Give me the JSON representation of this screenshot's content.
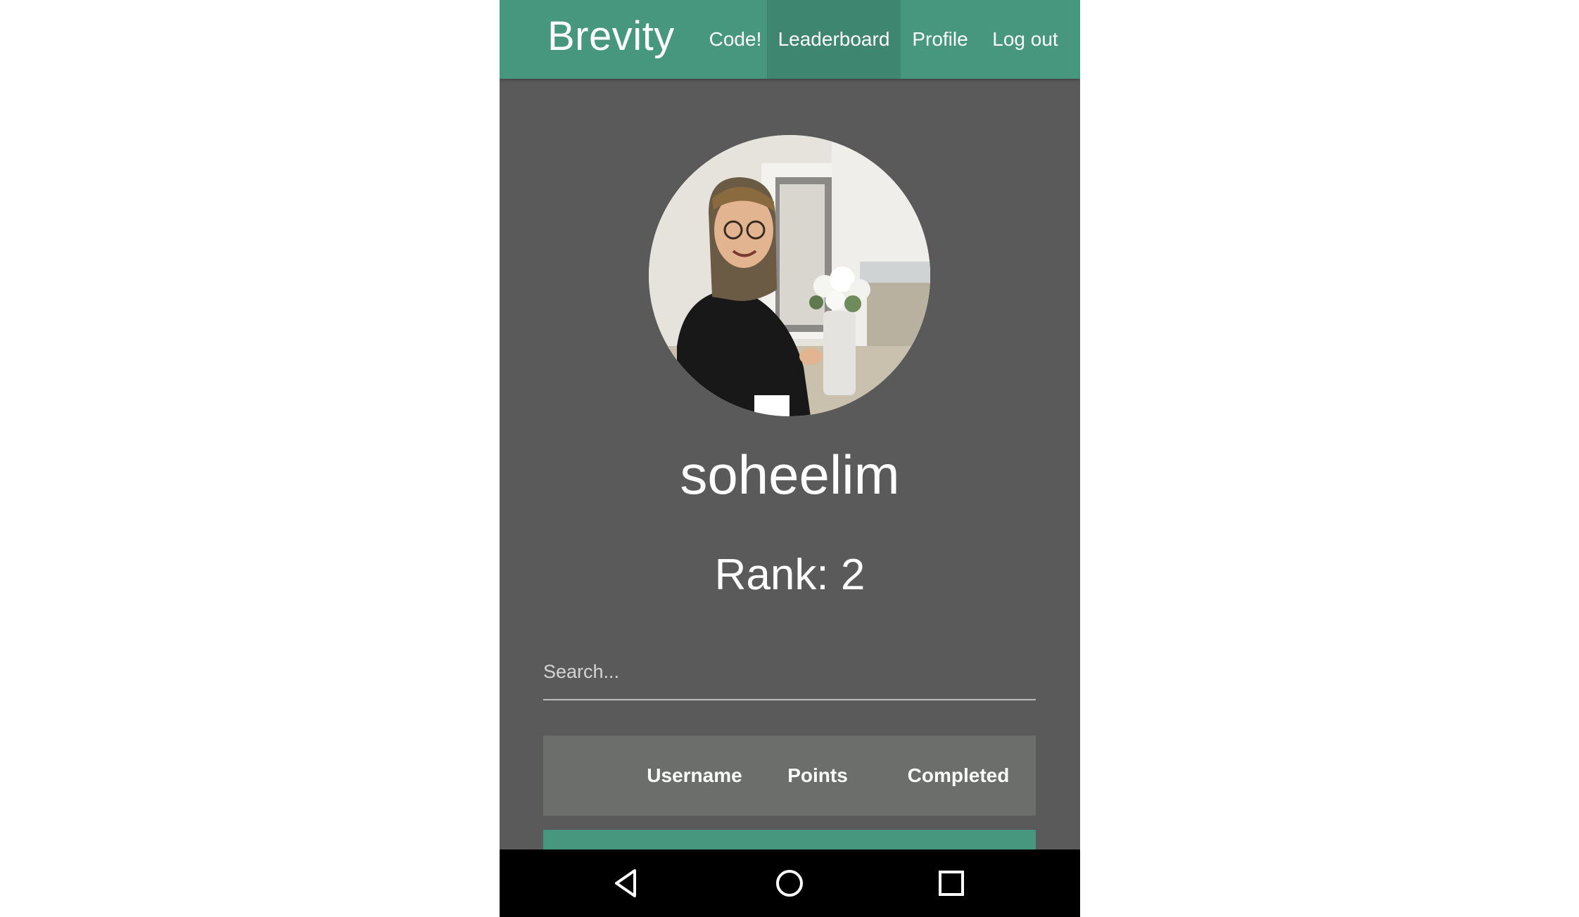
{
  "navbar": {
    "brand": "Brevity",
    "links": [
      "Code!",
      "Leaderboard",
      "Profile",
      "Log out"
    ],
    "active_link": "Leaderboard",
    "color": "#46977e"
  },
  "profile": {
    "username": "soheelim",
    "rank": "Rank: 2"
  },
  "search": {
    "placeholder": "Search..."
  },
  "table": {
    "columns": [
      "Username",
      "Points",
      "Completed"
    ]
  },
  "android_nav": {
    "buttons": [
      "back-icon",
      "home-icon",
      "recent-apps-icon"
    ]
  }
}
